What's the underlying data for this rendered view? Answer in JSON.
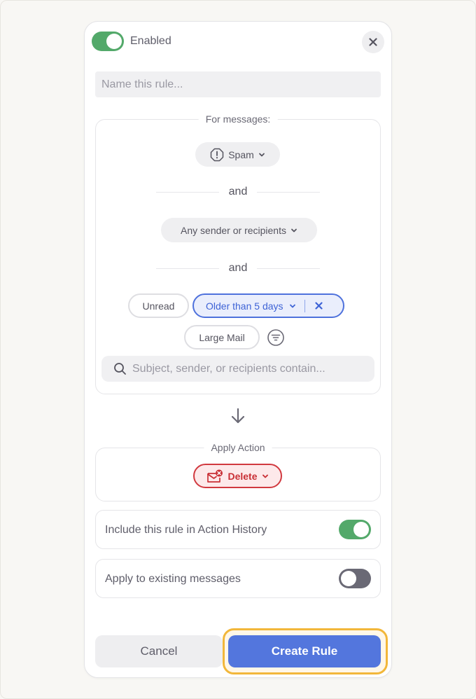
{
  "header": {
    "enabled_label": "Enabled",
    "enabled": true,
    "close_icon": "close-icon"
  },
  "rule_name": {
    "value": "",
    "placeholder": "Name this rule..."
  },
  "conditions": {
    "legend": "For messages:",
    "category": {
      "icon": "alert-octagon-icon",
      "label": "Spam"
    },
    "joiner_1": "and",
    "participants": {
      "label": "Any sender or recipients"
    },
    "joiner_2": "and",
    "filters": [
      {
        "label": "Unread",
        "selected": false
      },
      {
        "label": "Older than 5 days",
        "selected": true
      },
      {
        "label": "Large Mail",
        "selected": false
      }
    ],
    "more_filters_icon": "filter-icon",
    "search": {
      "value": "",
      "placeholder": "Subject, sender, or recipients contain..."
    }
  },
  "flow_icon": "arrow-down-icon",
  "action": {
    "legend": "Apply Action",
    "label": "Delete",
    "icon": "mail-delete-icon",
    "color": "#d1393f"
  },
  "options": [
    {
      "label": "Include this rule in Action History",
      "enabled": true
    },
    {
      "label": "Apply to existing messages",
      "enabled": false
    }
  ],
  "footer": {
    "cancel_label": "Cancel",
    "create_label": "Create Rule"
  },
  "colors": {
    "accent": "#5376dd",
    "toggle_on": "#53a96a",
    "toggle_off": "#6a6975",
    "focus_ring": "#f2b73a",
    "danger": "#d1393f"
  }
}
